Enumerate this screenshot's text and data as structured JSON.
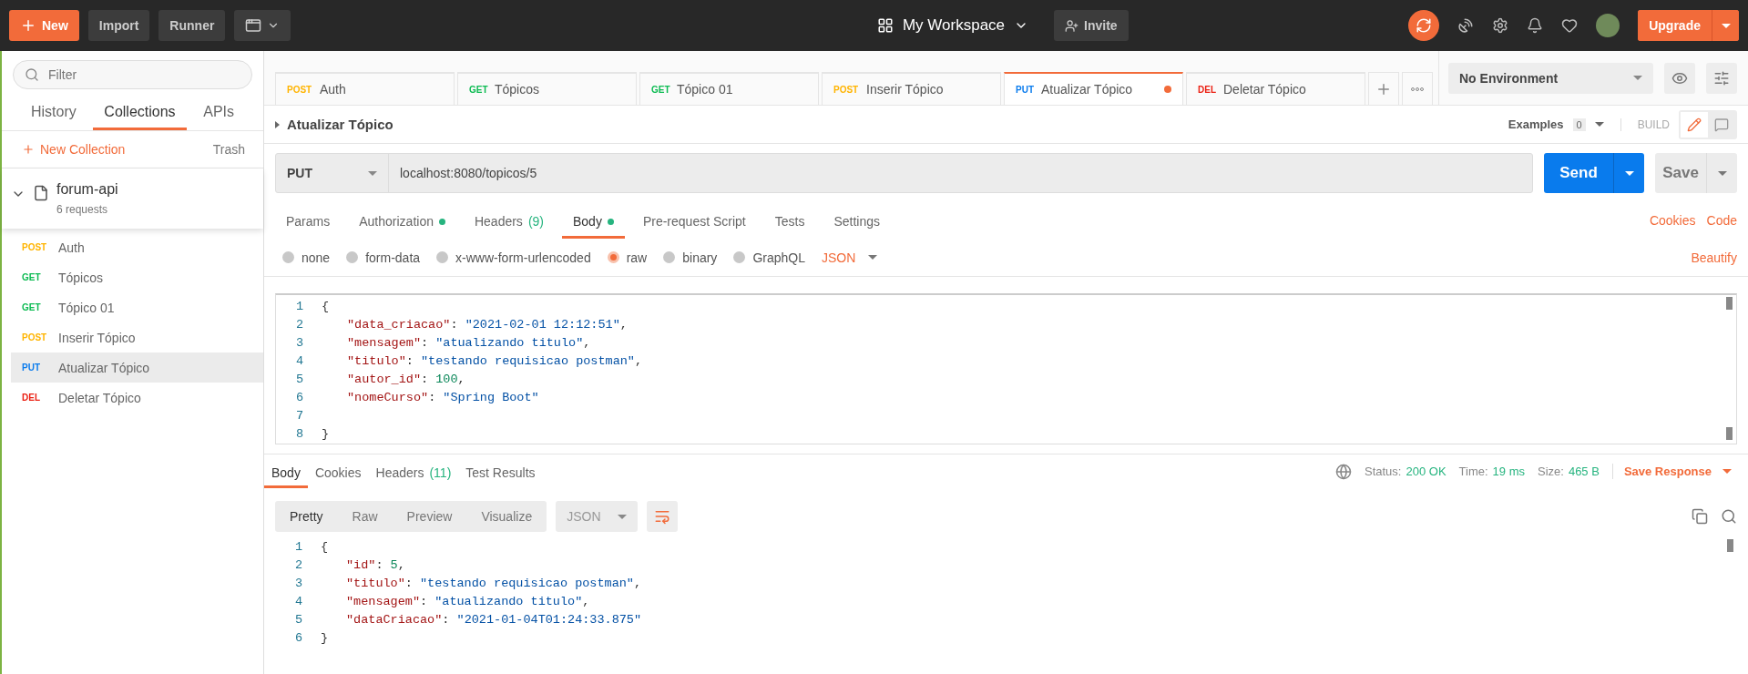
{
  "topbar": {
    "new_button": "New",
    "buttons": [
      "Import",
      "Runner"
    ],
    "workspace": "My Workspace",
    "invite": "Invite",
    "upgrade": "Upgrade"
  },
  "sidebar": {
    "filter_placeholder": "Filter",
    "tabs": [
      {
        "label": "History",
        "selected": false
      },
      {
        "label": "Collections",
        "selected": true
      },
      {
        "label": "APIs",
        "selected": false
      }
    ],
    "new_collection": "New Collection",
    "trash": "Trash",
    "collection": {
      "name": "forum-api",
      "count": "6 requests",
      "expanded": true
    },
    "items": [
      {
        "method": "POST",
        "name": "Auth",
        "selected": false
      },
      {
        "method": "GET",
        "name": "Tópicos",
        "selected": false
      },
      {
        "method": "GET",
        "name": "Tópico 01",
        "selected": false
      },
      {
        "method": "POST",
        "name": "Inserir Tópico",
        "selected": false
      },
      {
        "method": "PUT",
        "name": "Atualizar Tópico",
        "selected": true
      },
      {
        "method": "DEL",
        "name": "Deletar Tópico",
        "selected": false
      }
    ]
  },
  "open_tabs": [
    {
      "method": "POST",
      "name": "Auth",
      "selected": false,
      "unsaved": false
    },
    {
      "method": "GET",
      "name": "Tópicos",
      "selected": false,
      "unsaved": false
    },
    {
      "method": "GET",
      "name": "Tópico 01",
      "selected": false,
      "unsaved": false
    },
    {
      "method": "POST",
      "name": "Inserir Tópico",
      "selected": false,
      "unsaved": false
    },
    {
      "method": "PUT",
      "name": "Atualizar Tópico",
      "selected": true,
      "unsaved": true
    },
    {
      "method": "DEL",
      "name": "Deletar Tópico",
      "selected": false,
      "unsaved": false
    }
  ],
  "environment": "No Environment",
  "request": {
    "title": "Atualizar Tópico",
    "examples_label": "Examples",
    "examples_count": "0",
    "build": "BUILD",
    "method": "PUT",
    "url": "localhost:8080/topicos/5",
    "send": "Send",
    "save": "Save",
    "tabs": [
      {
        "label": "Params",
        "selected": false,
        "dot": false
      },
      {
        "label": "Authorization",
        "selected": false,
        "dot": true
      },
      {
        "label": "Headers",
        "count": "(9)",
        "selected": false,
        "dot": false
      },
      {
        "label": "Body",
        "selected": true,
        "dot": true
      },
      {
        "label": "Pre-request Script",
        "selected": false,
        "dot": false
      },
      {
        "label": "Tests",
        "selected": false,
        "dot": false
      },
      {
        "label": "Settings",
        "selected": false,
        "dot": false
      }
    ],
    "links": [
      "Cookies",
      "Code"
    ],
    "body_types": [
      {
        "label": "none",
        "selected": false
      },
      {
        "label": "form-data",
        "selected": false
      },
      {
        "label": "x-www-form-urlencoded",
        "selected": false
      },
      {
        "label": "raw",
        "selected": true
      },
      {
        "label": "binary",
        "selected": false
      },
      {
        "label": "GraphQL",
        "selected": false
      }
    ],
    "format": "JSON",
    "beautify": "Beautify",
    "code": [
      {
        "n": "1",
        "tokens": [
          {
            "kind": "punct",
            "text": "{"
          }
        ]
      },
      {
        "n": "2",
        "tokens": [
          {
            "kind": "key",
            "text": "\"data_criacao\""
          },
          {
            "kind": "punct",
            "text": ": "
          },
          {
            "kind": "str",
            "text": "\"2021-02-01 12:12:51\""
          },
          {
            "kind": "punct",
            "text": ","
          }
        ]
      },
      {
        "n": "3",
        "tokens": [
          {
            "kind": "key",
            "text": "\"mensagem\""
          },
          {
            "kind": "punct",
            "text": ": "
          },
          {
            "kind": "str",
            "text": "\"atualizando titulo\""
          },
          {
            "kind": "punct",
            "text": ","
          }
        ]
      },
      {
        "n": "4",
        "tokens": [
          {
            "kind": "key",
            "text": "\"titulo\""
          },
          {
            "kind": "punct",
            "text": ": "
          },
          {
            "kind": "str",
            "text": "\"testando requisicao postman\""
          },
          {
            "kind": "punct",
            "text": ","
          }
        ]
      },
      {
        "n": "5",
        "tokens": [
          {
            "kind": "key",
            "text": "\"autor_id\""
          },
          {
            "kind": "punct",
            "text": ": "
          },
          {
            "kind": "num",
            "text": "100"
          },
          {
            "kind": "punct",
            "text": ","
          }
        ]
      },
      {
        "n": "6",
        "tokens": [
          {
            "kind": "key",
            "text": "\"nomeCurso\""
          },
          {
            "kind": "punct",
            "text": ": "
          },
          {
            "kind": "str",
            "text": "\"Spring Boot\""
          }
        ]
      },
      {
        "n": "7"
      },
      {
        "n": "8",
        "tokens": [
          {
            "kind": "punct",
            "text": "}"
          }
        ]
      }
    ]
  },
  "response": {
    "tabs": [
      {
        "label": "Body",
        "selected": true
      },
      {
        "label": "Cookies",
        "selected": false
      },
      {
        "label": "Headers",
        "count": "(11)",
        "selected": false
      },
      {
        "label": "Test Results",
        "selected": false
      }
    ],
    "stats": [
      {
        "label": "Status:",
        "value": "200 OK"
      },
      {
        "label": "Time:",
        "value": "19 ms"
      },
      {
        "label": "Size:",
        "value": "465 B"
      }
    ],
    "save_response": "Save Response",
    "views": [
      {
        "label": "Pretty",
        "selected": true
      },
      {
        "label": "Raw",
        "selected": false
      },
      {
        "label": "Preview",
        "selected": false
      },
      {
        "label": "Visualize",
        "selected": false
      }
    ],
    "format": "JSON",
    "code": [
      {
        "n": "1",
        "tokens": [
          {
            "kind": "punct",
            "text": "{"
          }
        ]
      },
      {
        "n": "2",
        "tokens": [
          {
            "kind": "key",
            "text": "\"id\""
          },
          {
            "kind": "punct",
            "text": ": "
          },
          {
            "kind": "num",
            "text": "5"
          },
          {
            "kind": "punct",
            "text": ","
          }
        ]
      },
      {
        "n": "3",
        "tokens": [
          {
            "kind": "key",
            "text": "\"titulo\""
          },
          {
            "kind": "punct",
            "text": ": "
          },
          {
            "kind": "str",
            "text": "\"testando requisicao postman\""
          },
          {
            "kind": "punct",
            "text": ","
          }
        ]
      },
      {
        "n": "4",
        "tokens": [
          {
            "kind": "key",
            "text": "\"mensagem\""
          },
          {
            "kind": "punct",
            "text": ": "
          },
          {
            "kind": "str",
            "text": "\"atualizando titulo\""
          },
          {
            "kind": "punct",
            "text": ","
          }
        ]
      },
      {
        "n": "5",
        "tokens": [
          {
            "kind": "key",
            "text": "\"dataCriacao\""
          },
          {
            "kind": "punct",
            "text": ": "
          },
          {
            "kind": "str",
            "text": "\"2021-01-04T01:24:33.875\""
          }
        ]
      },
      {
        "n": "6",
        "tokens": [
          {
            "kind": "punct",
            "text": "}"
          }
        ]
      }
    ]
  }
}
